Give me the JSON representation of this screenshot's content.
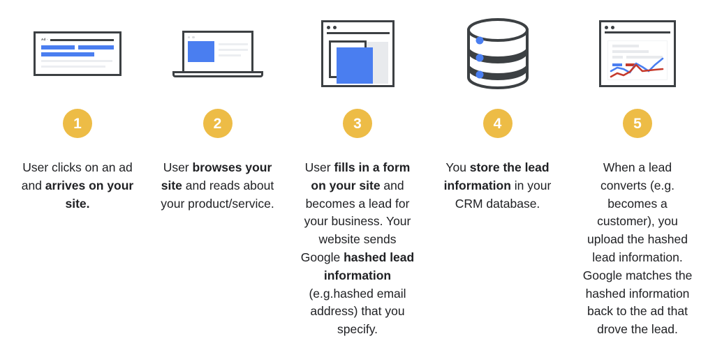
{
  "theme": {
    "badge_color": "#edbc46",
    "badge_text_color": "#ffffff",
    "ink": "#3c4043",
    "blue": "#4a7ef0",
    "red": "#c5392b",
    "gray": "#e8eaed",
    "background": "#ffffff"
  },
  "steps": [
    {
      "number": "1",
      "icon": "ad-result-card-icon",
      "ad_label": "Ad ·",
      "caption_parts": [
        {
          "text": "User clicks on an ad and ",
          "bold": false
        },
        {
          "text": "arrives on your site.",
          "bold": true
        }
      ],
      "caption_plain": "User clicks on an ad and arrives on your site."
    },
    {
      "number": "2",
      "icon": "laptop-browser-icon",
      "caption_parts": [
        {
          "text": "User ",
          "bold": false
        },
        {
          "text": "browses your site",
          "bold": true
        },
        {
          "text": " and reads about your product/service.",
          "bold": false
        }
      ],
      "caption_plain": "User browses your site and reads about your product/service."
    },
    {
      "number": "3",
      "icon": "form-window-icon",
      "caption_parts": [
        {
          "text": "User ",
          "bold": false
        },
        {
          "text": "fills in a form on your site",
          "bold": true
        },
        {
          "text": " and becomes a lead for your business. Your website sends Google ",
          "bold": false
        },
        {
          "text": "hashed lead information",
          "bold": true
        },
        {
          "text": " (e.g.hashed email address) that you specify.",
          "bold": false
        }
      ],
      "caption_plain": "User fills in a form on your site and becomes a lead for your business. Your website sends Google hashed lead information (e.g.hashed email address) that you specify."
    },
    {
      "number": "4",
      "icon": "database-icon",
      "caption_parts": [
        {
          "text": "You ",
          "bold": false
        },
        {
          "text": "store the lead information",
          "bold": true
        },
        {
          "text": " in your CRM database.",
          "bold": false
        }
      ],
      "caption_plain": "You store the lead information in your CRM database."
    },
    {
      "number": "5",
      "icon": "analytics-chart-window-icon",
      "caption_parts": [
        {
          "text": "When a lead converts (e.g. becomes a customer), you upload the hashed lead information. Google matches the hashed information back to the ad that drove the lead.",
          "bold": false
        }
      ],
      "caption_plain": "When a lead converts (e.g. becomes a customer), you upload the hashed lead information. Google matches the hashed information back to the ad that drove the lead."
    }
  ]
}
